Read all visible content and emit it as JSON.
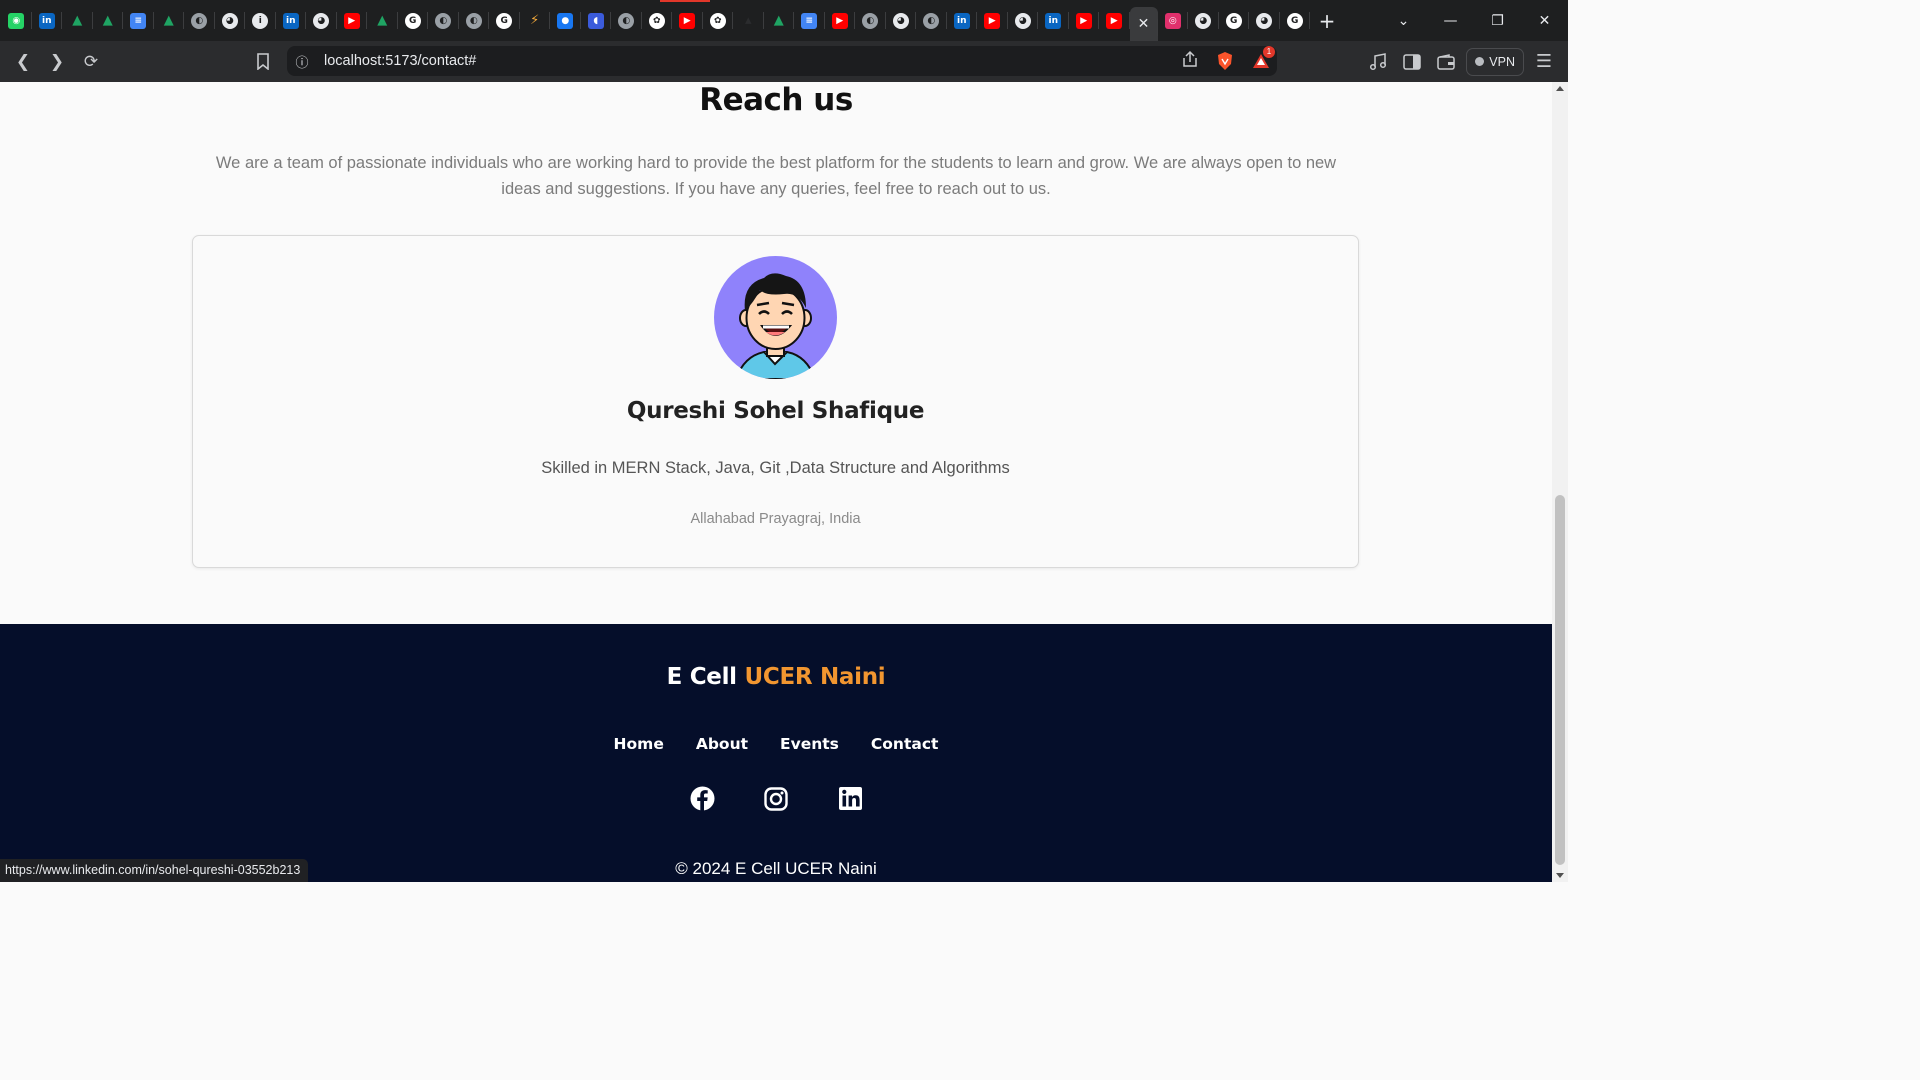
{
  "browser": {
    "tab_icons": [
      {
        "name": "whatsapp-icon",
        "color": "#25d366",
        "glyph": "◉"
      },
      {
        "name": "linkedin-icon",
        "color": "#0a66c2",
        "glyph": "in"
      },
      {
        "name": "google-drive-icon",
        "color": "#1fa463",
        "glyph": "▲"
      },
      {
        "name": "google-drive-icon",
        "color": "#1fa463",
        "glyph": "▲"
      },
      {
        "name": "google-docs-icon",
        "color": "#4285f4",
        "glyph": "≡"
      },
      {
        "name": "google-drive-icon",
        "color": "#1fa463",
        "glyph": "▲"
      },
      {
        "name": "globe-icon",
        "color": "#9aa0a6",
        "glyph": "◐"
      },
      {
        "name": "github-icon",
        "color": "#e8eaed",
        "glyph": "◕"
      },
      {
        "name": "info-icon",
        "color": "#e8eaed",
        "glyph": "i"
      },
      {
        "name": "linkedin-icon",
        "color": "#0a66c2",
        "glyph": "in"
      },
      {
        "name": "github-icon",
        "color": "#e8eaed",
        "glyph": "◕"
      },
      {
        "name": "youtube-icon",
        "color": "#ff0000",
        "glyph": "▶"
      },
      {
        "name": "google-drive-icon",
        "color": "#1fa463",
        "glyph": "▲"
      },
      {
        "name": "google-icon",
        "color": "#ffffff",
        "glyph": "G"
      },
      {
        "name": "globe-icon",
        "color": "#9aa0a6",
        "glyph": "◐"
      },
      {
        "name": "globe-icon",
        "color": "#9aa0a6",
        "glyph": "◐"
      },
      {
        "name": "google-icon",
        "color": "#ffffff",
        "glyph": "G"
      },
      {
        "name": "generic-site-icon",
        "color": "#f2a83a",
        "glyph": "⚡"
      },
      {
        "name": "messenger-icon",
        "color": "#1877f2",
        "glyph": "●"
      },
      {
        "name": "app-icon",
        "color": "#3b5bdb",
        "glyph": "◖"
      },
      {
        "name": "globe-icon",
        "color": "#9aa0a6",
        "glyph": "◐"
      },
      {
        "name": "chatgpt-icon",
        "color": "#ffffff",
        "glyph": "✿"
      },
      {
        "name": "youtube-icon",
        "color": "#ff0000",
        "glyph": "▶"
      },
      {
        "name": "chatgpt-icon",
        "color": "#ffffff",
        "glyph": "✿"
      },
      {
        "name": "dark-site-icon",
        "color": "#2b2c2e",
        "glyph": "▴"
      },
      {
        "name": "google-drive-icon",
        "color": "#1fa463",
        "glyph": "▲"
      },
      {
        "name": "google-docs-icon",
        "color": "#4285f4",
        "glyph": "≡"
      },
      {
        "name": "youtube-icon",
        "color": "#ff0000",
        "glyph": "▶"
      },
      {
        "name": "globe-icon",
        "color": "#9aa0a6",
        "glyph": "◐"
      },
      {
        "name": "github-icon",
        "color": "#e8eaed",
        "glyph": "◕"
      },
      {
        "name": "globe-icon",
        "color": "#9aa0a6",
        "glyph": "◐"
      },
      {
        "name": "linkedin-icon",
        "color": "#0a66c2",
        "glyph": "in"
      },
      {
        "name": "youtube-icon",
        "color": "#ff0000",
        "glyph": "▶"
      },
      {
        "name": "github-icon",
        "color": "#e8eaed",
        "glyph": "◕"
      },
      {
        "name": "linkedin-icon",
        "color": "#0a66c2",
        "glyph": "in"
      },
      {
        "name": "youtube-icon",
        "color": "#ff0000",
        "glyph": "▶"
      },
      {
        "name": "youtube-icon",
        "color": "#ff0000",
        "glyph": "▶"
      },
      {
        "name": "close-icon",
        "color": "#e8eaed",
        "glyph": "✕",
        "active": true
      },
      {
        "name": "instagram-icon",
        "color": "#e1306c",
        "glyph": "◎"
      },
      {
        "name": "github-icon",
        "color": "#e8eaed",
        "glyph": "◕"
      },
      {
        "name": "google-icon",
        "color": "#ffffff",
        "glyph": "G"
      },
      {
        "name": "github-icon",
        "color": "#e8eaed",
        "glyph": "◕"
      },
      {
        "name": "google-icon",
        "color": "#ffffff",
        "glyph": "G"
      }
    ],
    "url": "localhost:5173/contact#",
    "vpn_label": "VPN",
    "notification_count": "1",
    "status_url": "https://www.linkedin.com/in/sohel-qureshi-03552b213"
  },
  "page": {
    "heading": "Reach us",
    "intro": "We are a team of passionate individuals who are working hard to provide the best platform for the students to learn and grow. We are always open to new ideas and suggestions. If you have any queries, feel free to reach out to us.",
    "card": {
      "name": "Qureshi Sohel Shafique",
      "skills": "Skilled in MERN Stack, Java, Git ,Data Structure and Algorithms",
      "location": "Allahabad Prayagraj, India"
    }
  },
  "footer": {
    "brand_prefix": "E Cell",
    "brand_accent": "UCER Naini",
    "nav": [
      "Home",
      "About",
      "Events",
      "Contact"
    ],
    "social": [
      "facebook-icon",
      "instagram-icon",
      "linkedin-icon"
    ],
    "copyright": "© 2024 E Cell UCER Naini"
  },
  "colors": {
    "footer_bg": "#050e2a",
    "accent": "#f29630",
    "avatar_bg": "#8f82fb"
  }
}
